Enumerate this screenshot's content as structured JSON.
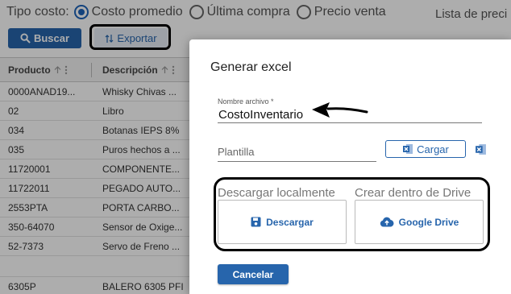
{
  "filters": {
    "cost_type_label": "Tipo costo:",
    "options": [
      {
        "label": "Costo promedio",
        "selected": true
      },
      {
        "label": "Última compra",
        "selected": false
      },
      {
        "label": "Precio venta",
        "selected": false
      }
    ],
    "price_list_label": "Lista de preci"
  },
  "toolbar": {
    "search_label": "Buscar",
    "export_label": "Exportar"
  },
  "table": {
    "headers": [
      "Producto",
      "Descripción"
    ],
    "rows": [
      {
        "producto": "0000ANAD19...",
        "descripcion": "Whisky Chivas ..."
      },
      {
        "producto": "02",
        "descripcion": "Libro"
      },
      {
        "producto": "034",
        "descripcion": "Botanas IEPS 8%"
      },
      {
        "producto": "035",
        "descripcion": "Puros hechos a ..."
      },
      {
        "producto": "11720001",
        "descripcion": "COMPONENTE..."
      },
      {
        "producto": "11722011",
        "descripcion": "PEGADO AUTO..."
      },
      {
        "producto": "2553PTA",
        "descripcion": "PORTA CARBO..."
      },
      {
        "producto": "350-64070",
        "descripcion": "Sensor de Oxige..."
      },
      {
        "producto": "52-7373",
        "descripcion": "Servo de Freno ..."
      },
      {
        "producto": "",
        "descripcion": ""
      },
      {
        "producto": "6305P",
        "descripcion": "BALERO 6305 PFI"
      }
    ]
  },
  "dialog": {
    "title": "Generar excel",
    "filename_label": "Nombre archivo *",
    "filename_value": "CostoInventario",
    "template_placeholder": "Plantilla",
    "load_label": "Cargar",
    "download_local_label": "Descargar localmente",
    "download_button": "Descargar",
    "drive_label": "Crear dentro de Drive",
    "drive_button": "Google Drive",
    "cancel_button": "Cancelar"
  },
  "colors": {
    "primary": "#2765ac",
    "overlay": "rgba(0,0,0,0.32)",
    "annotation": "#000000"
  },
  "icons": [
    "search-icon",
    "sort-arrows-icon",
    "sort-up-icon",
    "kebab-icon",
    "excel-icon",
    "save-icon",
    "cloud-upload-icon",
    "annotation-arrow"
  ]
}
